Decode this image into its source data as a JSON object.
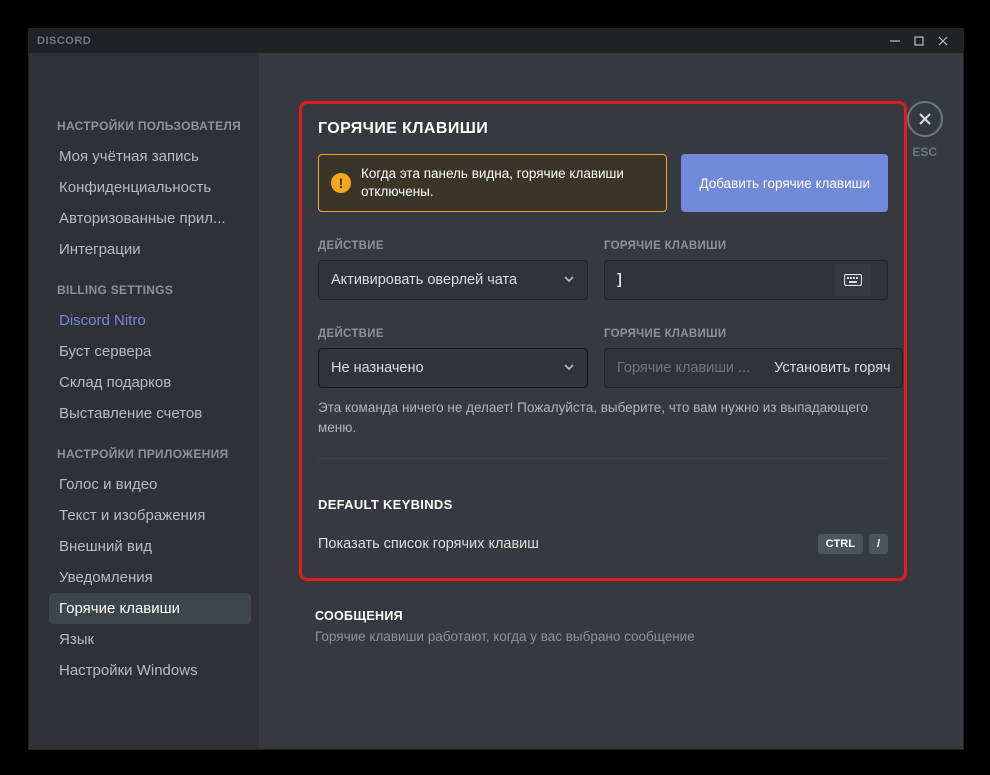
{
  "titlebar": {
    "app_name": "DISCORD"
  },
  "esc": {
    "label": "ESC"
  },
  "sidebar": {
    "headers": {
      "user": "НАСТРОЙКИ ПОЛЬЗОВАТЕЛЯ",
      "billing": "BILLING SETTINGS",
      "app": "НАСТРОЙКИ ПРИЛОЖЕНИЯ"
    },
    "items": {
      "account": "Моя учётная запись",
      "privacy": "Конфиденциальность",
      "auth_apps": "Авторизованные прил...",
      "integrations": "Интеграции",
      "nitro": "Discord Nitro",
      "boost": "Буст сервера",
      "gift_inv": "Склад подарков",
      "billing": "Выставление счетов",
      "voice": "Голос и видео",
      "text_img": "Текст и изображения",
      "appearance": "Внешний вид",
      "notif": "Уведомления",
      "keybinds": "Горячие клавиши",
      "lang": "Язык",
      "windows": "Настройки Windows"
    }
  },
  "page": {
    "title": "ГОРЯЧИЕ КЛАВИШИ",
    "warning": "Когда эта панель видна, горячие клавиши отключены.",
    "add_btn": "Добавить горячие клавиши",
    "labels": {
      "action": "ДЕЙСТВИЕ",
      "keybind": "ГОРЯЧИЕ КЛАВИШИ"
    },
    "row1": {
      "action_value": "Активировать оверлей чата",
      "key_value": "]"
    },
    "row2": {
      "action_value": "Не назначено",
      "placeholder": "Горячие клавиши ...",
      "install": "Установить горяч",
      "help": "Эта команда ничего не делает! Пожалуйста, выберите, что вам нужно из выпадающего меню."
    },
    "default_title": "DEFAULT KEYBINDS",
    "show_list": "Показать список горячих клавиш",
    "chip_ctrl": "CTRL",
    "chip_slash": "/",
    "messages": {
      "title": "СООБЩЕНИЯ",
      "help": "Горячие клавиши работают, когда у вас выбрано сообщение"
    }
  }
}
